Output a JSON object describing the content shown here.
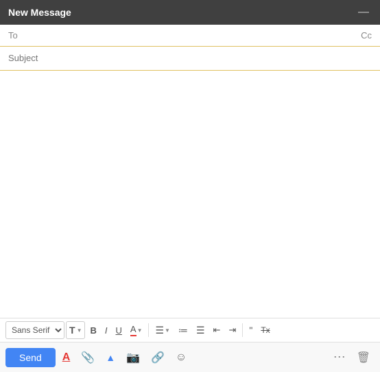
{
  "title_bar": {
    "title": "New Message",
    "minimize_label": "—",
    "colors": {
      "bg": "#404040",
      "text": "#ffffff"
    }
  },
  "fields": {
    "to_label": "To",
    "to_placeholder": "",
    "cc_label": "Cc",
    "subject_label": "Subject",
    "subject_placeholder": ""
  },
  "toolbar": {
    "font_family": "Sans Serif",
    "font_size_icon": "T",
    "bold": "B",
    "italic": "I",
    "underline": "U",
    "text_color": "A",
    "align": "≡",
    "ordered_list": "1.",
    "unordered_list": "•",
    "indent_less": "◂≡",
    "indent_more": "≡▸",
    "quote": "❝",
    "clear_format": "Tx"
  },
  "bottom_bar": {
    "send_label": "Send",
    "format_icon": "A",
    "attach_icon": "📎",
    "drive_icon": "▲",
    "photo_icon": "📷",
    "link_icon": "🔗",
    "emoji_icon": "☺",
    "more_icon": "⋯",
    "delete_icon": "🗑"
  }
}
